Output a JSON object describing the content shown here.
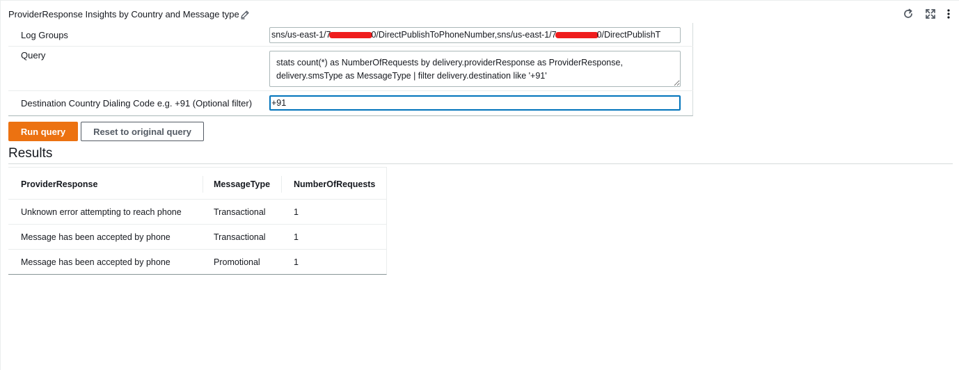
{
  "widget": {
    "title": "ProviderResponse Insights by Country and Message type",
    "edit_icon": "pencil-icon",
    "header_icons": [
      "refresh-icon",
      "fullscreen-icon",
      "more-vertical-icon"
    ]
  },
  "form": {
    "log_groups": {
      "label": "Log Groups",
      "value_part1": "sns/us-east-1/7",
      "value_part2": "0/DirectPublishToPhoneNumber,sns/us-east-1/7",
      "value_part3": "0/DirectPublishT"
    },
    "query": {
      "label": "Query",
      "value": "stats count(*) as NumberOfRequests by delivery.providerResponse as ProviderResponse, delivery.smsType as MessageType | filter delivery.destination like '+91'"
    },
    "destination": {
      "label": "Destination Country Dialing Code e.g. +91 (Optional filter)",
      "value": "+91"
    }
  },
  "buttons": {
    "run_label": "Run query",
    "reset_label": "Reset to original query"
  },
  "results": {
    "title": "Results",
    "columns": [
      "ProviderResponse",
      "MessageType",
      "NumberOfRequests"
    ],
    "rows": [
      [
        "Unknown error attempting to reach phone",
        "Transactional",
        "1"
      ],
      [
        "Message has been accepted by phone",
        "Transactional",
        "1"
      ],
      [
        "Message has been accepted by phone",
        "Promotional",
        "1"
      ]
    ]
  },
  "colors": {
    "primary_button": "#ec7211",
    "focus_border": "#0073bb",
    "redaction": "#ef1d1d"
  }
}
